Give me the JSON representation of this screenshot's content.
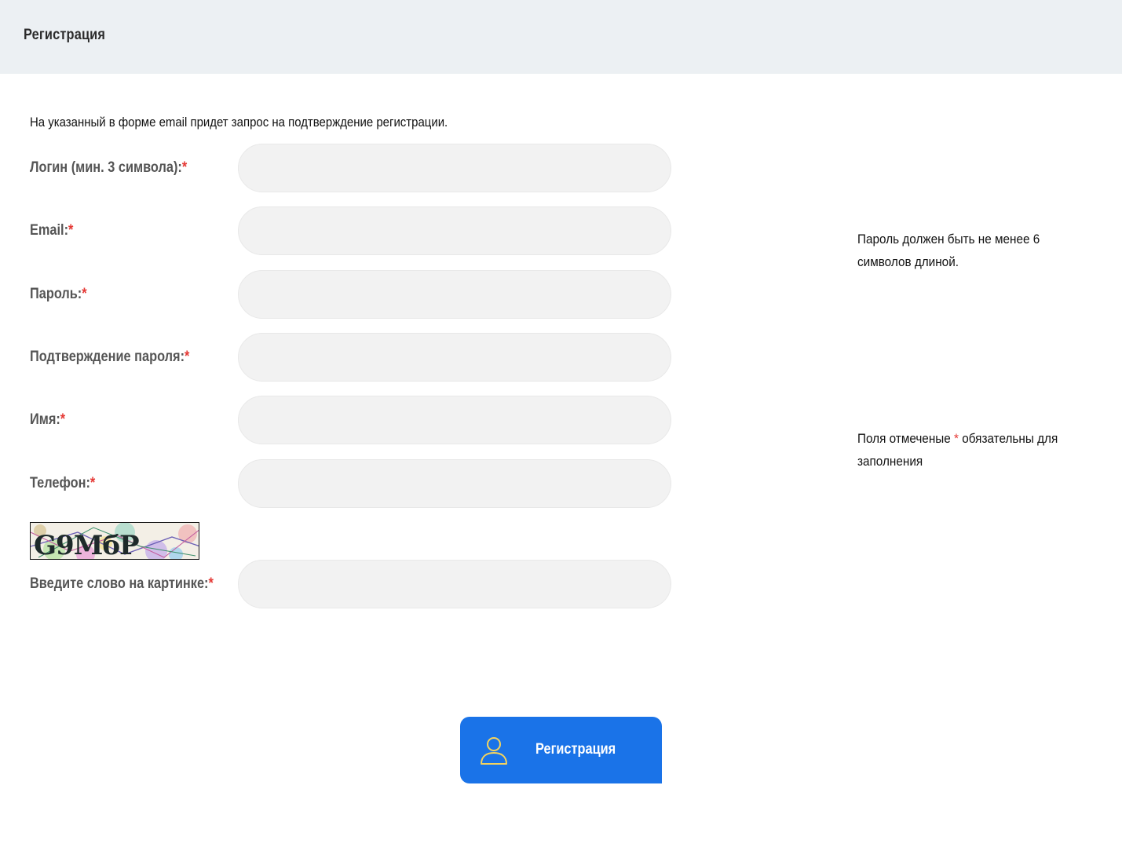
{
  "header": {
    "title": "Регистрация"
  },
  "intro": "На указанный в форме email придет запрос на подтверждение регистрации.",
  "required_mark": "*",
  "fields": {
    "login": {
      "label": "Логин (мин. 3 символа):",
      "value": "",
      "placeholder": ""
    },
    "email": {
      "label": "Email:",
      "value": "",
      "placeholder": ""
    },
    "password": {
      "label": "Пароль:",
      "value": "",
      "placeholder": ""
    },
    "password_confirm": {
      "label": "Подтверждение пароля:",
      "value": "",
      "placeholder": ""
    },
    "name": {
      "label": "Имя:",
      "value": "",
      "placeholder": ""
    },
    "phone": {
      "label": "Телефон:",
      "value": "",
      "placeholder": ""
    },
    "captcha_word": {
      "label": "Введите слово на картинке:",
      "value": "",
      "placeholder": ""
    }
  },
  "captcha": {
    "text": "G9МбP"
  },
  "hints": {
    "password": "Пароль должен быть не менее 6 символов длиной.",
    "required_prefix": "Поля отмеченые ",
    "required_suffix": " обязательны для заполнения"
  },
  "submit": {
    "label": "Регистрация",
    "icon": "user-icon"
  },
  "colors": {
    "header_bg": "#ecf0f3",
    "accent": "#1a73e8",
    "required": "#e53935",
    "icon_stroke": "#f4d35e"
  }
}
